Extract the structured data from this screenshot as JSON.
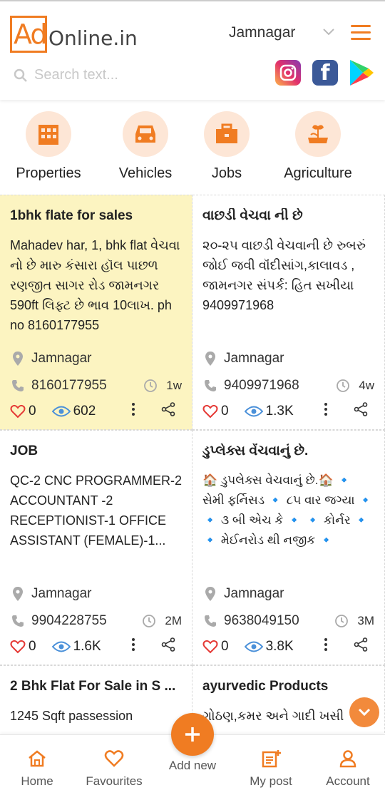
{
  "header": {
    "logo_ad": "Ad",
    "logo_rest": "Online.in",
    "city": "Jamnagar",
    "search_placeholder": "Search text..."
  },
  "colors": {
    "accent": "#f07c22",
    "highlight": "#fcf4c1"
  },
  "categories": [
    {
      "label": "Properties",
      "icon": "building-icon"
    },
    {
      "label": "Vehicles",
      "icon": "car-icon"
    },
    {
      "label": "Jobs",
      "icon": "briefcase-icon"
    },
    {
      "label": "Agriculture",
      "icon": "plant-icon"
    }
  ],
  "listings": [
    {
      "title": "1bhk flate for sales",
      "desc": "Mahadev har, 1, bhk flat વેચવા નો છે મારુ કંસારા હૉલ પાછળ રણજીત સાગર રોડ જામનગર 590ft લિફ્ટ છે ભાવ 10લાખ. ph no 8160177955",
      "location": "Jamnagar",
      "phone": "8160177955",
      "time": "1w",
      "likes": "0",
      "views": "602"
    },
    {
      "title": "વાછડી વેચવા ની છે",
      "desc": "૨૦-૨૫ વાછડી વેચવાની છે રુબરું જોઈ જવી વૉંદીસાંગ,કાલાવડ , જામનગર સંપર્ક: હિત સખીયા 9409971968",
      "location": "Jamnagar",
      "phone": "9409971968",
      "time": "4w",
      "likes": "0",
      "views": "1.3K"
    },
    {
      "title": "JOB",
      "desc": "QC-2 CNC PROGRAMMER-2 ACCOUNTANT -2 RECEPTIONIST-1 OFFICE ASSISTANT (FEMALE)-1...",
      "location": "Jamnagar",
      "phone": "9904228755",
      "time": "2M",
      "likes": "0",
      "views": "1.6K"
    },
    {
      "title": "ડુપ્લેક્સ વેંચવાનું છે.",
      "desc": "🏠 ડુપલેક્સ વેચવાનું છે.🏠 🔹 સેમી ફર્નિસડ 🔹 ૮૫ વાર જગ્યા 🔹 🔹 ૩ બી એચ કે 🔹 🔹 કોર્નર 🔹 🔹 મેઈનરોડ થી નજીક 🔹",
      "location": "Jamnagar",
      "phone": "9638049150",
      "time": "3M",
      "likes": "0",
      "views": "3.8K"
    },
    {
      "title": "2 Bhk Flat For Sale in S ...",
      "desc": "1245 Sqft passession"
    },
    {
      "title": "ayurvedic Products",
      "desc": "ગોઠણ,કમર અને ગાદી ખસી"
    }
  ],
  "nav": {
    "home": "Home",
    "favourites": "Favourites",
    "add_new": "Add new",
    "my_post": "My post",
    "account": "Account"
  }
}
